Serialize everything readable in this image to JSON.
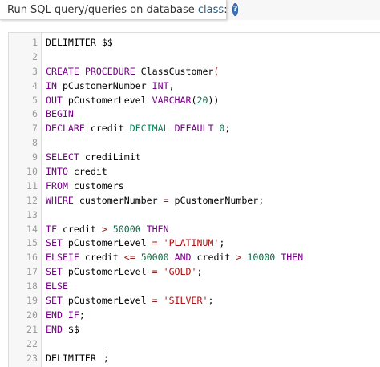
{
  "header": {
    "title_prefix": "Run SQL query/queries on database ",
    "database": "class",
    "title_suffix": ":",
    "help_icon": "help-icon"
  },
  "editor": {
    "lines": [
      {
        "n": "1",
        "tokens": [
          [
            "DELIMITER $$",
            ""
          ]
        ]
      },
      {
        "n": "2",
        "tokens": []
      },
      {
        "n": "3",
        "tokens": [
          [
            "CREATE PROCEDURE ",
            "kw"
          ],
          [
            "ClassCustomer",
            ""
          ],
          [
            "(",
            "op"
          ]
        ]
      },
      {
        "n": "4",
        "tokens": [
          [
            "IN ",
            "kw"
          ],
          [
            "pCustomerNumber ",
            ""
          ],
          [
            "INT",
            "kw"
          ],
          [
            ",",
            ""
          ]
        ]
      },
      {
        "n": "5",
        "tokens": [
          [
            "OUT ",
            "kw"
          ],
          [
            "pCustomerLevel ",
            ""
          ],
          [
            "VARCHAR",
            "kw"
          ],
          [
            "(",
            ""
          ],
          [
            "20",
            "num"
          ],
          [
            "))",
            ""
          ]
        ]
      },
      {
        "n": "6",
        "tokens": [
          [
            "BEGIN",
            "kw"
          ]
        ]
      },
      {
        "n": "7",
        "tokens": [
          [
            "DECLARE ",
            "kw"
          ],
          [
            "credit ",
            ""
          ],
          [
            "DECIMAL ",
            "type"
          ],
          [
            "DEFAULT ",
            "kw"
          ],
          [
            "0",
            "num"
          ],
          [
            ";",
            ""
          ]
        ]
      },
      {
        "n": "8",
        "tokens": []
      },
      {
        "n": "9",
        "tokens": [
          [
            "SELECT ",
            "kw"
          ],
          [
            "crediLimit",
            ""
          ]
        ]
      },
      {
        "n": "10",
        "tokens": [
          [
            "INTO ",
            "kw"
          ],
          [
            "credit",
            ""
          ]
        ]
      },
      {
        "n": "11",
        "tokens": [
          [
            "FROM ",
            "kw"
          ],
          [
            "customers",
            ""
          ]
        ]
      },
      {
        "n": "12",
        "tokens": [
          [
            "WHERE ",
            "kw"
          ],
          [
            "customerNumber ",
            ""
          ],
          [
            "=",
            "op"
          ],
          [
            " pCustomerNumber;",
            ""
          ]
        ]
      },
      {
        "n": "13",
        "tokens": []
      },
      {
        "n": "14",
        "tokens": [
          [
            "IF ",
            "kw"
          ],
          [
            "credit ",
            ""
          ],
          [
            ">",
            "op"
          ],
          [
            " ",
            ""
          ],
          [
            "50000",
            "num"
          ],
          [
            " ",
            ""
          ],
          [
            "THEN",
            "kw"
          ]
        ]
      },
      {
        "n": "15",
        "tokens": [
          [
            "SET ",
            "kw"
          ],
          [
            "pCustomerLevel ",
            ""
          ],
          [
            "=",
            "op"
          ],
          [
            " ",
            ""
          ],
          [
            "'PLATINUM'",
            "str"
          ],
          [
            ";",
            ""
          ]
        ]
      },
      {
        "n": "16",
        "tokens": [
          [
            "ELSEIF ",
            "kw"
          ],
          [
            "credit ",
            ""
          ],
          [
            "<=",
            "op"
          ],
          [
            " ",
            ""
          ],
          [
            "50000",
            "num"
          ],
          [
            " ",
            ""
          ],
          [
            "AND ",
            "kw"
          ],
          [
            "credit ",
            ""
          ],
          [
            ">",
            "op"
          ],
          [
            " ",
            ""
          ],
          [
            "10000",
            "num"
          ],
          [
            " ",
            ""
          ],
          [
            "THEN",
            "kw"
          ]
        ]
      },
      {
        "n": "17",
        "tokens": [
          [
            "SET ",
            "kw"
          ],
          [
            "pCustomerLevel ",
            ""
          ],
          [
            "=",
            "op"
          ],
          [
            " ",
            ""
          ],
          [
            "'GOLD'",
            "str"
          ],
          [
            ";",
            ""
          ]
        ]
      },
      {
        "n": "18",
        "tokens": [
          [
            "ELSE",
            "kw"
          ]
        ]
      },
      {
        "n": "19",
        "tokens": [
          [
            "SET ",
            "kw"
          ],
          [
            "pCustomerLevel ",
            ""
          ],
          [
            "=",
            "op"
          ],
          [
            " ",
            ""
          ],
          [
            "'SILVER'",
            "str"
          ],
          [
            ";",
            ""
          ]
        ]
      },
      {
        "n": "20",
        "tokens": [
          [
            "END ",
            "kw"
          ],
          [
            "IF",
            "kw"
          ],
          [
            ";",
            ""
          ]
        ]
      },
      {
        "n": "21",
        "tokens": [
          [
            "END ",
            "kw"
          ],
          [
            "$$",
            ""
          ]
        ]
      },
      {
        "n": "22",
        "tokens": []
      },
      {
        "n": "23",
        "tokens": [
          [
            "DELIMITER ",
            ""
          ],
          [
            "CURSOR",
            "cursor"
          ],
          [
            ";",
            ""
          ]
        ]
      }
    ]
  }
}
